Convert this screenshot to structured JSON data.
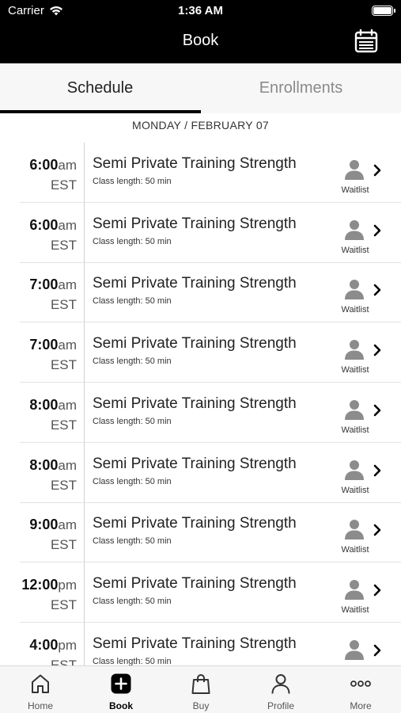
{
  "status_bar": {
    "carrier": "Carrier",
    "time": "1:36 AM"
  },
  "header": {
    "title": "Book",
    "calendar_icon": "calendar-icon"
  },
  "tabs": [
    {
      "label": "Schedule",
      "selected": true
    },
    {
      "label": "Enrollments",
      "selected": false
    }
  ],
  "date_header": "MONDAY / FEBRUARY 07",
  "classes": [
    {
      "hm": "6:00",
      "ampm": "am",
      "tz": "EST",
      "name": "Semi Private Training Strength",
      "length": "Class length: 50 min",
      "status": "Waitlist"
    },
    {
      "hm": "6:00",
      "ampm": "am",
      "tz": "EST",
      "name": "Semi Private Training Strength",
      "length": "Class length: 50 min",
      "status": "Waitlist"
    },
    {
      "hm": "7:00",
      "ampm": "am",
      "tz": "EST",
      "name": "Semi Private Training Strength",
      "length": "Class length: 50 min",
      "status": "Waitlist"
    },
    {
      "hm": "7:00",
      "ampm": "am",
      "tz": "EST",
      "name": "Semi Private Training Strength",
      "length": "Class length: 50 min",
      "status": "Waitlist"
    },
    {
      "hm": "8:00",
      "ampm": "am",
      "tz": "EST",
      "name": "Semi Private Training Strength",
      "length": "Class length: 50 min",
      "status": "Waitlist"
    },
    {
      "hm": "8:00",
      "ampm": "am",
      "tz": "EST",
      "name": "Semi Private Training Strength",
      "length": "Class length: 50 min",
      "status": "Waitlist"
    },
    {
      "hm": "9:00",
      "ampm": "am",
      "tz": "EST",
      "name": "Semi Private Training Strength",
      "length": "Class length: 50 min",
      "status": "Waitlist"
    },
    {
      "hm": "12:00",
      "ampm": "pm",
      "tz": "EST",
      "name": "Semi Private Training Strength",
      "length": "Class length: 50 min",
      "status": "Waitlist"
    },
    {
      "hm": "4:00",
      "ampm": "pm",
      "tz": "EST",
      "name": "Semi Private Training Strength",
      "length": "Class length: 50 min",
      "status": ""
    }
  ],
  "bottom_nav": [
    {
      "label": "Home",
      "icon": "home-icon",
      "active": false
    },
    {
      "label": "Book",
      "icon": "plus-square-icon",
      "active": true
    },
    {
      "label": "Buy",
      "icon": "shopping-bag-icon",
      "active": false
    },
    {
      "label": "Profile",
      "icon": "user-icon",
      "active": false
    },
    {
      "label": "More",
      "icon": "more-dots-icon",
      "active": false
    }
  ]
}
